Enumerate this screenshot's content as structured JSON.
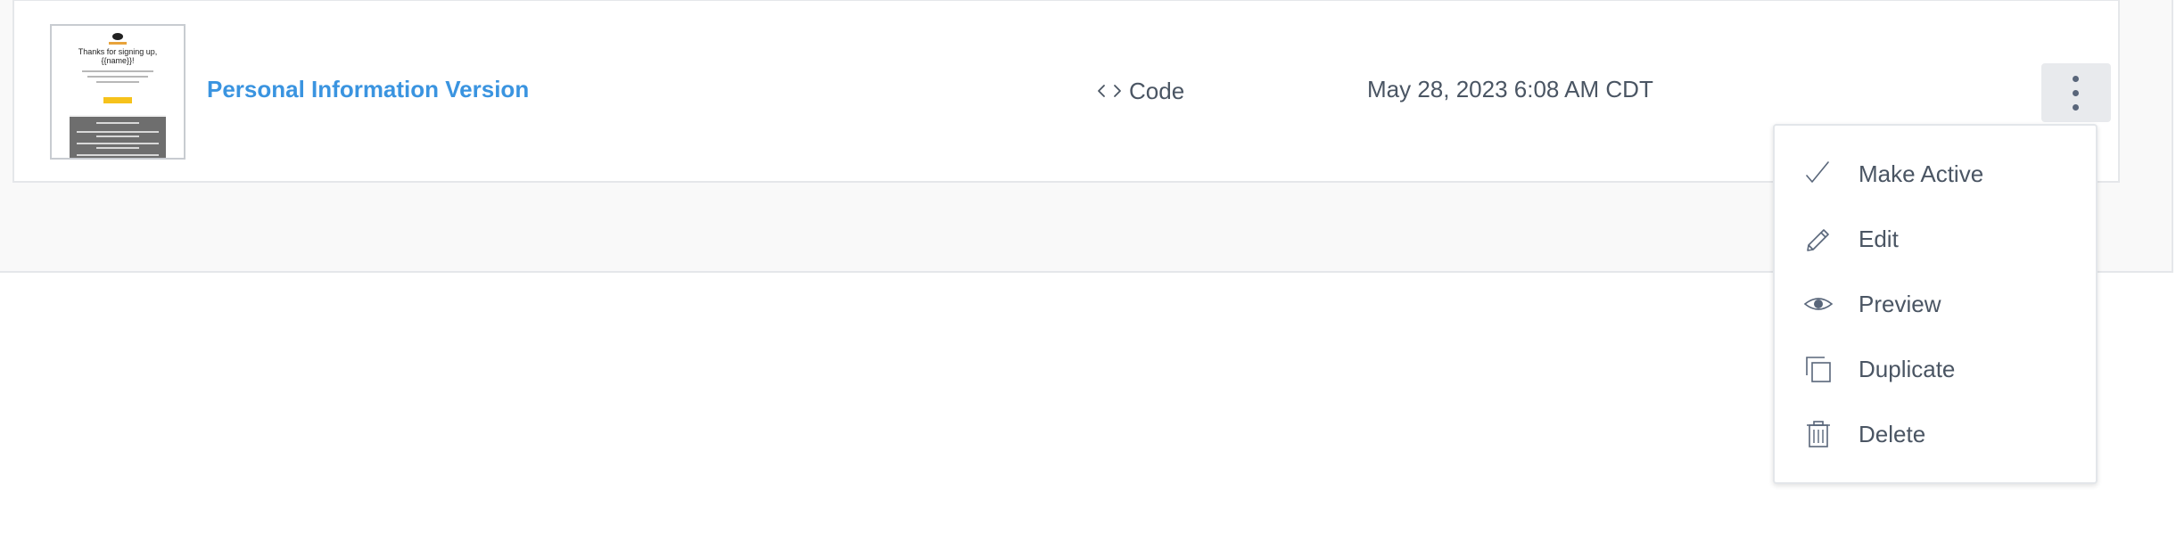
{
  "row": {
    "thumbnail": {
      "title_line1": "Thanks for signing up,",
      "title_line2": "{{name}}!"
    },
    "title": "Personal Information Version",
    "editor_type": "Code",
    "editor_icon": "code-brackets-icon",
    "timestamp": "May 28, 2023 6:08 AM CDT",
    "actions_icon": "kebab-icon"
  },
  "menu": {
    "items": [
      {
        "label": "Make Active",
        "icon": "check-icon"
      },
      {
        "label": "Edit",
        "icon": "pencil-icon"
      },
      {
        "label": "Preview",
        "icon": "eye-icon"
      },
      {
        "label": "Duplicate",
        "icon": "duplicate-icon"
      },
      {
        "label": "Delete",
        "icon": "trash-icon"
      }
    ]
  },
  "colors": {
    "link": "#3a94e0",
    "text": "#4a5563",
    "icon": "#59667a",
    "kebab_bg": "#e8eaed"
  }
}
